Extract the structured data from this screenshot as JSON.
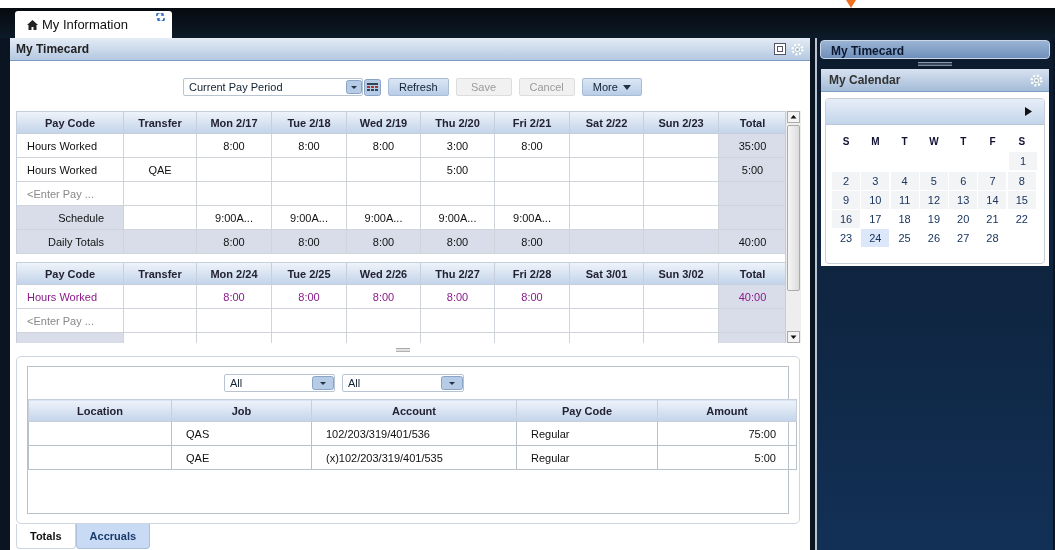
{
  "tab": {
    "label": "My Information",
    "selected": true
  },
  "timecard": {
    "title": "My Timecard",
    "period": {
      "value": "Current Pay Period"
    },
    "buttons": [
      {
        "label": "Refresh",
        "disabled": false,
        "kind": "plain"
      },
      {
        "label": "Save",
        "disabled": true,
        "kind": "plain"
      },
      {
        "label": "Cancel",
        "disabled": true,
        "kind": "plain"
      },
      {
        "label": "More",
        "disabled": false,
        "kind": "menu"
      }
    ],
    "weeks": [
      {
        "columns": [
          "Pay Code",
          "Transfer",
          "Mon 2/17",
          "Tue 2/18",
          "Wed 2/19",
          "Thu 2/20",
          "Fri 2/21",
          "Sat 2/22",
          "Sun 2/23",
          "Total"
        ],
        "rows": [
          {
            "kind": "entry",
            "edited": false,
            "cells": [
              "Hours Worked",
              "",
              "8:00",
              "8:00",
              "8:00",
              "3:00",
              "8:00",
              "",
              "",
              "35:00"
            ]
          },
          {
            "kind": "entry",
            "edited": false,
            "cells": [
              "Hours Worked",
              "QAE",
              "",
              "",
              "",
              "5:00",
              "",
              "",
              "",
              "5:00"
            ]
          },
          {
            "kind": "placeholder",
            "edited": false,
            "cells": [
              "<Enter Pay ..."
            ]
          },
          {
            "kind": "schedule",
            "edited": false,
            "cells": [
              "Schedule",
              "",
              "9:00A...",
              "9:00A...",
              "9:00A...",
              "9:00A...",
              "9:00A...",
              "",
              "",
              ""
            ]
          },
          {
            "kind": "totals",
            "edited": false,
            "cells": [
              "Daily Totals",
              "",
              "8:00",
              "8:00",
              "8:00",
              "8:00",
              "8:00",
              "",
              "",
              "40:00"
            ]
          }
        ]
      },
      {
        "columns": [
          "Pay Code",
          "Transfer",
          "Mon 2/24",
          "Tue 2/25",
          "Wed 2/26",
          "Thu 2/27",
          "Fri 2/28",
          "Sat 3/01",
          "Sun 3/02",
          "Total"
        ],
        "rows": [
          {
            "kind": "entry",
            "edited": true,
            "cells": [
              "Hours Worked",
              "",
              "8:00",
              "8:00",
              "8:00",
              "8:00",
              "8:00",
              "",
              "",
              "40:00"
            ]
          },
          {
            "kind": "placeholder",
            "edited": false,
            "cells": [
              "<Enter Pay ..."
            ]
          },
          {
            "kind": "schedule",
            "cells": []
          }
        ]
      }
    ]
  },
  "summary": {
    "filters": [
      {
        "value": "All"
      },
      {
        "value": "All"
      }
    ],
    "columns": [
      "Location",
      "Job",
      "Account",
      "Pay Code",
      "Amount"
    ],
    "rows": [
      [
        "",
        "QAS",
        "102/203/319/401/536",
        "Regular",
        "75:00"
      ],
      [
        "",
        "QAE",
        "(x)102/203/319/401/535",
        "Regular",
        "5:00"
      ]
    ],
    "tabs": [
      {
        "label": "Totals",
        "selected": true
      },
      {
        "label": "Accruals",
        "selected": false
      }
    ]
  },
  "sidebar": {
    "collapsed_panel": {
      "title": "My Timecard"
    },
    "calendar": {
      "title": "My Calendar",
      "weekdays": [
        "S",
        "M",
        "T",
        "W",
        "T",
        "F",
        "S"
      ],
      "weeks": [
        {
          "days": [
            {
              "day": "1",
              "shaded": true,
              "selected": false
            }
          ]
        },
        {
          "days": [
            {
              "day": "2",
              "shaded": true,
              "selected": false
            },
            {
              "day": "3",
              "shaded": true,
              "selected": false
            },
            {
              "day": "4",
              "shaded": true,
              "selected": false
            },
            {
              "day": "5",
              "shaded": true,
              "selected": false
            },
            {
              "day": "6",
              "shaded": true,
              "selected": false
            },
            {
              "day": "7",
              "shaded": true,
              "selected": false
            },
            {
              "day": "8",
              "shaded": true,
              "selected": false
            }
          ]
        },
        {
          "days": [
            {
              "day": "9",
              "shaded": true,
              "selected": false
            },
            {
              "day": "10",
              "shaded": true,
              "selected": false
            },
            {
              "day": "11",
              "shaded": true,
              "selected": false
            },
            {
              "day": "12",
              "shaded": true,
              "selected": false
            },
            {
              "day": "13",
              "shaded": true,
              "selected": false
            },
            {
              "day": "14",
              "shaded": true,
              "selected": false
            },
            {
              "day": "15",
              "shaded": true,
              "selected": false
            }
          ]
        },
        {
          "days": [
            {
              "day": "16",
              "shaded": true,
              "selected": false
            },
            {
              "day": "17",
              "shaded": false,
              "selected": false
            },
            {
              "day": "18",
              "shaded": false,
              "selected": false
            },
            {
              "day": "19",
              "shaded": false,
              "selected": false
            },
            {
              "day": "20",
              "shaded": false,
              "selected": false
            },
            {
              "day": "21",
              "shaded": false,
              "selected": false
            },
            {
              "day": "22",
              "shaded": false,
              "selected": false
            }
          ]
        },
        {
          "days": [
            {
              "day": "23",
              "shaded": false,
              "selected": false
            },
            {
              "day": "24",
              "shaded": false,
              "selected": true
            },
            {
              "day": "25",
              "shaded": false,
              "selected": false
            },
            {
              "day": "26",
              "shaded": false,
              "selected": false
            },
            {
              "day": "27",
              "shaded": false,
              "selected": false
            },
            {
              "day": "28",
              "shaded": false,
              "selected": false
            }
          ]
        }
      ]
    }
  }
}
